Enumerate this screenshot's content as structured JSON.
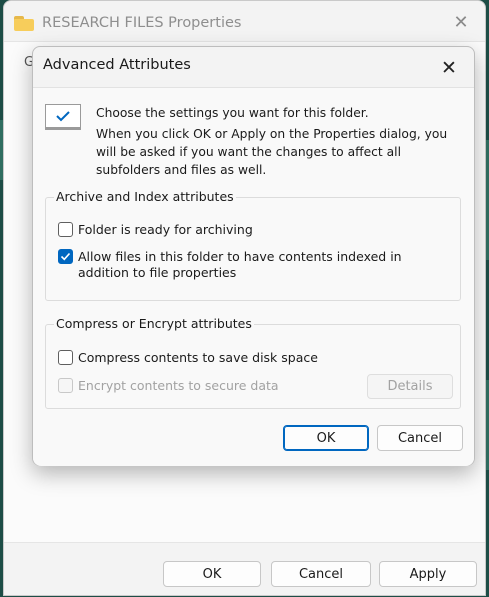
{
  "properties_window": {
    "title": "RESEARCH FILES Properties",
    "tab_letter": "G",
    "buttons": {
      "ok": "OK",
      "cancel": "Cancel",
      "apply": "Apply"
    }
  },
  "dialog": {
    "title": "Advanced Attributes",
    "info_line1": "Choose the settings you want for this folder.",
    "info_line2": "When you click OK or Apply on the Properties dialog, you will be asked if you want the changes to affect all subfolders and files as well.",
    "archive_group": {
      "label": "Archive and Index attributes",
      "options": [
        {
          "label": "Folder is ready for archiving",
          "checked": false
        },
        {
          "label": "Allow files in this folder to have contents indexed in addition to file properties",
          "checked": true
        }
      ]
    },
    "compress_group": {
      "label": "Compress or Encrypt attributes",
      "options": [
        {
          "label": "Compress contents to save disk space",
          "checked": false,
          "enabled": true
        },
        {
          "label": "Encrypt contents to secure data",
          "checked": false,
          "enabled": false
        }
      ],
      "details_button": "Details"
    },
    "buttons": {
      "ok": "OK",
      "cancel": "Cancel"
    }
  },
  "colors": {
    "accent": "#0067c0",
    "folder": "#f7cd5b",
    "desktop": "#1d4d46"
  },
  "icons": {
    "window_icon": "folder-icon",
    "close": "close-icon",
    "info": "checked-box-icon"
  }
}
